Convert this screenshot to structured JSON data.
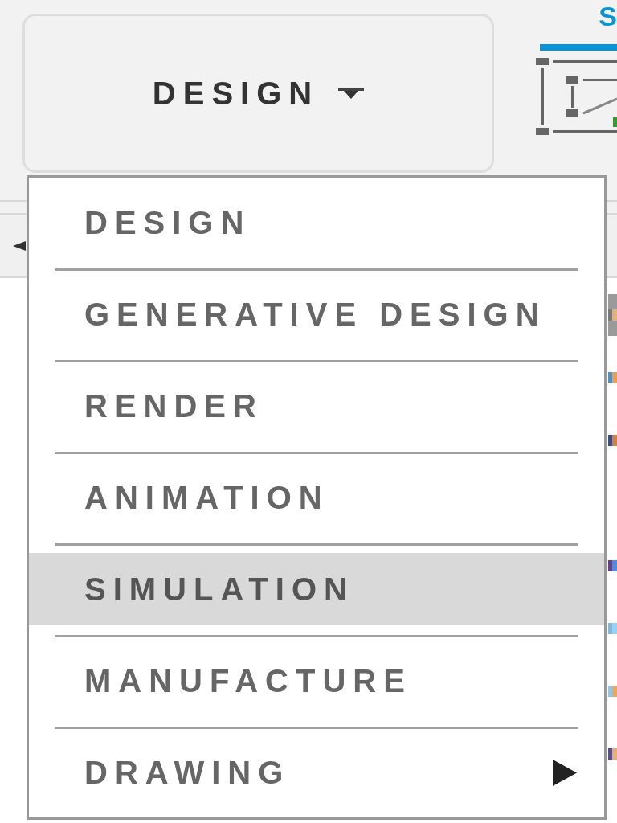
{
  "workspace_button": {
    "label": "DESIGN"
  },
  "toolbar_tabs": [
    {
      "label": "S",
      "selected": true
    }
  ],
  "workspace_menu": {
    "items": [
      {
        "label": "DESIGN",
        "kind": "item",
        "selected": false
      },
      {
        "label": "GENERATIVE DESIGN",
        "kind": "item",
        "selected": false
      },
      {
        "label": "RENDER",
        "kind": "item",
        "selected": false
      },
      {
        "label": "ANIMATION",
        "kind": "item",
        "selected": false
      },
      {
        "label": "SIMULATION",
        "kind": "item",
        "selected": true
      },
      {
        "label": "MANUFACTURE",
        "kind": "item",
        "selected": false
      },
      {
        "label": "DRAWING",
        "kind": "submenu",
        "selected": false
      }
    ]
  }
}
